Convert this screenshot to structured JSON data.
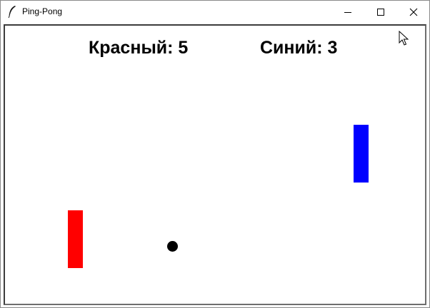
{
  "window": {
    "title": "Ping-Pong",
    "icon": "feather-icon",
    "controls": [
      "minimize-icon",
      "maximize-icon",
      "close-icon"
    ]
  },
  "game": {
    "red_label": "Красный",
    "red_score": 5,
    "red_score_text": "Красный: 5",
    "blue_label": "Синий",
    "blue_score": 3,
    "blue_score_text": "Синий: 3",
    "red_color": "#ff0000",
    "blue_color": "#0000ff",
    "ball_color": "#000000",
    "background_color": "#ffffff"
  }
}
